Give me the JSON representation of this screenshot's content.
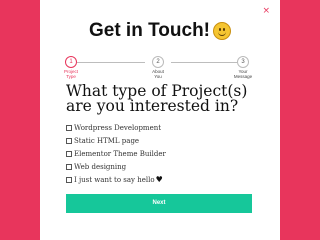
{
  "modal": {
    "title": "Get in Touch!",
    "close_label": "×"
  },
  "steps": [
    {
      "number": "1",
      "label_line1": "Project",
      "label_line2": "Type",
      "active": true
    },
    {
      "number": "2",
      "label_line1": "About",
      "label_line2": "You",
      "active": false
    },
    {
      "number": "3",
      "label_line1": "Your",
      "label_line2": "Message",
      "active": false
    }
  ],
  "question": "What type of Project(s) are you interested in?",
  "options": [
    {
      "label": "Wordpress Development",
      "checked": false
    },
    {
      "label": "Static HTML page",
      "checked": false
    },
    {
      "label": "Elementor Theme Builder",
      "checked": false
    },
    {
      "label": "Web designing",
      "checked": false
    },
    {
      "label": "I just want to say hello",
      "checked": false
    }
  ],
  "next_label": "Next",
  "colors": {
    "background": "#e8355c",
    "accent": "#e8355c",
    "button": "#16c79a"
  },
  "icons": {
    "title_emoji": "smiley-face-icon",
    "close": "close-icon",
    "option_5_suffix": "heart-icon"
  }
}
